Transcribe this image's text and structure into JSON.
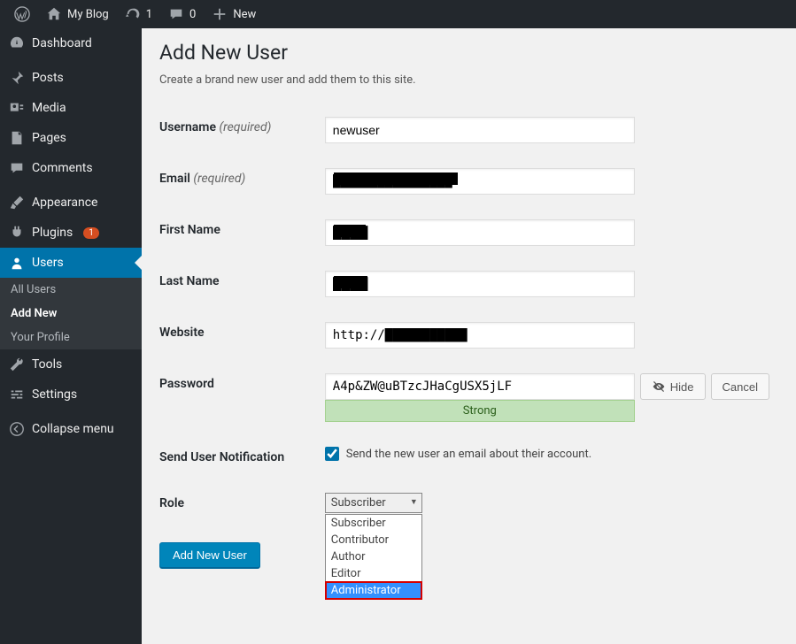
{
  "adminbar": {
    "site_name": "My Blog",
    "updates_count": "1",
    "comments_count": "0",
    "new_label": "New"
  },
  "sidebar": {
    "items": [
      {
        "label": "Dashboard",
        "icon": "dashboard"
      },
      {
        "label": "Posts",
        "icon": "pin"
      },
      {
        "label": "Media",
        "icon": "media"
      },
      {
        "label": "Pages",
        "icon": "pages"
      },
      {
        "label": "Comments",
        "icon": "comment"
      },
      {
        "label": "Appearance",
        "icon": "brush"
      },
      {
        "label": "Plugins",
        "icon": "plug",
        "badge": "1"
      },
      {
        "label": "Users",
        "icon": "user",
        "current": true
      },
      {
        "label": "Tools",
        "icon": "wrench"
      },
      {
        "label": "Settings",
        "icon": "sliders"
      }
    ],
    "users_submenu": [
      {
        "label": "All Users"
      },
      {
        "label": "Add New",
        "current": true
      },
      {
        "label": "Your Profile"
      }
    ],
    "collapse_label": "Collapse menu"
  },
  "page": {
    "title": "Add New User",
    "subtitle": "Create a brand new user and add them to this site."
  },
  "form": {
    "required_label": "(required)",
    "username": {
      "label": "Username",
      "value": "newuser"
    },
    "email": {
      "label": "Email",
      "value": "████████████████"
    },
    "first_name": {
      "label": "First Name",
      "value": "████"
    },
    "last_name": {
      "label": "Last Name",
      "value": "████"
    },
    "website": {
      "label": "Website",
      "value": "http://███████████"
    },
    "password": {
      "label": "Password",
      "value": "A4p&ZW@uBTzcJHaCgUSX5jLF",
      "hide_label": "Hide",
      "cancel_label": "Cancel",
      "strength": "Strong"
    },
    "notification": {
      "label": "Send User Notification",
      "checkbox_label": "Send the new user an email about their account.",
      "checked": true
    },
    "role": {
      "label": "Role",
      "selected": "Subscriber",
      "options": [
        "Subscriber",
        "Contributor",
        "Author",
        "Editor",
        "Administrator"
      ],
      "highlighted": "Administrator"
    },
    "submit_label": "Add New User"
  }
}
